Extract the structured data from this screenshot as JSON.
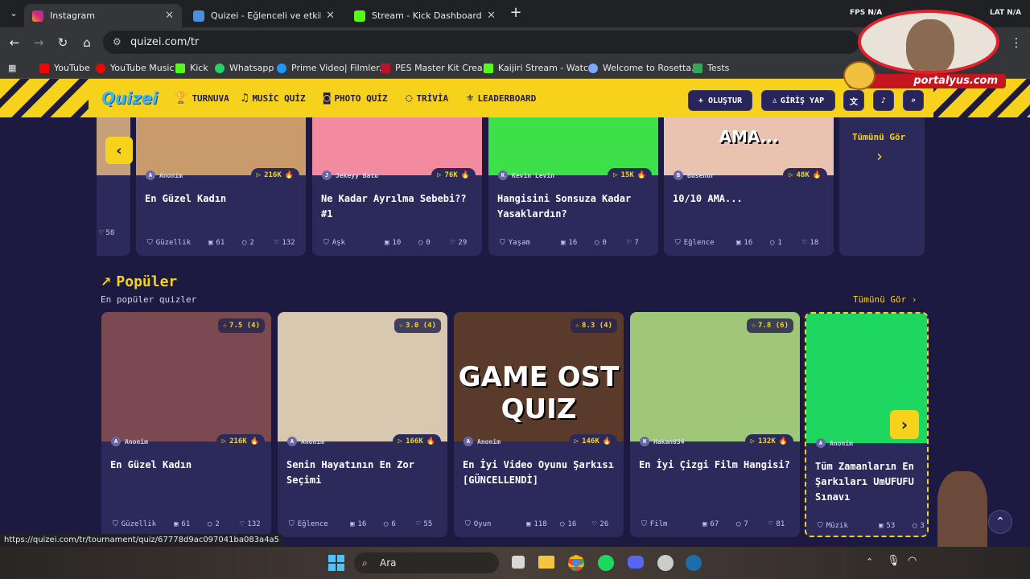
{
  "browser": {
    "tabs": [
      {
        "label": "Instagram",
        "active": true
      },
      {
        "label": "Quizei - Eğlenceli ve etkileşimli",
        "active": false
      },
      {
        "label": "Stream - Kick Dashboard",
        "active": false
      }
    ],
    "url": "quizei.com/tr",
    "overlay_labels": {
      "fps": "FPS",
      "fps_value": "N/A",
      "lat": "LAT",
      "lat_value": "N/A"
    },
    "bookmarks": [
      "YouTube",
      "YouTube Music",
      "Kick",
      "Whatsapp",
      "Prime Video| Filmler...",
      "PES Master Kit Crea...",
      "Kaijiri Stream - Watc...",
      "Welcome to Rosetta...",
      "Tests"
    ],
    "status_url": "https://quizei.com/tr/tournament/quiz/67778d9ac097041ba083a4a5"
  },
  "stream_overlay": {
    "brand": "portalyus.com"
  },
  "site": {
    "logo": "Quizei",
    "nav": [
      {
        "label": "TURNUVA",
        "icon": "trophy-icon"
      },
      {
        "label": "MUSİC QUİZ",
        "icon": "music-icon"
      },
      {
        "label": "PHOTO QUİZ",
        "icon": "camera-icon"
      },
      {
        "label": "TRİVİA",
        "icon": "chat-icon"
      },
      {
        "label": "LEADERBOARD",
        "icon": "award-icon"
      }
    ],
    "create_label": "+ OLUŞTUR",
    "login_label": "GİRİŞ YAP"
  },
  "top_row": {
    "partial_card": {
      "plays": "🔥",
      "likes": "58"
    },
    "cards": [
      {
        "author": "Anonim",
        "author_initial": "A",
        "plays": "216K",
        "title": "En Güzel Kadın",
        "category": "Güzellik",
        "items": "61",
        "comments": "2",
        "likes": "132",
        "thumb_color": "#c99a6a"
      },
      {
        "author": "Jekeyy Batu",
        "author_initial": "J",
        "plays": "76K",
        "title": "Ne Kadar Ayrılma Sebebi?? #1",
        "category": "Aşk",
        "items": "10",
        "comments": "0",
        "likes": "29",
        "thumb_color": "#f28aa0"
      },
      {
        "author": "Kevin Levin",
        "author_initial": "K",
        "plays": "15K",
        "title": "Hangisini Sonsuza Kadar Yasaklardın?",
        "category": "Yaşam",
        "items": "16",
        "comments": "0",
        "likes": "7",
        "thumb_color": "#3ee04a"
      },
      {
        "author": "Busenur",
        "author_initial": "B",
        "plays": "48K",
        "title": "10/10 AMA...",
        "category": "Eğlence",
        "items": "16",
        "comments": "1",
        "likes": "18",
        "thumb_color": "#e9c2b0",
        "thumb_text": "AMA..."
      }
    ],
    "see_all": "Tümünü Gör"
  },
  "popular": {
    "title": "Popüler",
    "subtitle": "En popüler quizler",
    "see_all": "Tümünü Gör",
    "cards": [
      {
        "rating": "7.5",
        "votes": "(4)",
        "author": "Anonim",
        "author_initial": "A",
        "plays": "216K",
        "title": "En Güzel Kadın",
        "category": "Güzellik",
        "items": "61",
        "comments": "2",
        "likes": "132",
        "thumb_color": "#7a4a50"
      },
      {
        "rating": "3.0",
        "votes": "(4)",
        "author": "Anonim",
        "author_initial": "A",
        "plays": "166K",
        "title": "Senin Hayatının En Zor Seçimi",
        "category": "Eğlence",
        "items": "16",
        "comments": "6",
        "likes": "55",
        "thumb_color": "#d8c8b0"
      },
      {
        "rating": "8.3",
        "votes": "(4)",
        "author": "Anonim",
        "author_initial": "A",
        "plays": "146K",
        "title": "En İyi Video Oyunu Şarkısı [GÜNCELLENDİ]",
        "category": "Oyun",
        "items": "118",
        "comments": "16",
        "likes": "26",
        "thumb_color": "#5a3a2a",
        "thumb_text": "GAME OST QUIZ"
      },
      {
        "rating": "7.8",
        "votes": "(6)",
        "author": "Hakan034",
        "author_initial": "H",
        "plays": "132K",
        "title": "En İyi Çizgi Film Hangisi?",
        "category": "Film",
        "items": "67",
        "comments": "7",
        "likes": "81",
        "thumb_color": "#9ec878"
      },
      {
        "author": "Anonim",
        "author_initial": "A",
        "title": "Tüm Zamanların En Şarkıları UmUFUFU Sınavı",
        "category": "Müzik",
        "items": "53",
        "comments": "3",
        "thumb_color": "#1ed760"
      }
    ]
  },
  "taskbar": {
    "search_label": "Ara"
  }
}
